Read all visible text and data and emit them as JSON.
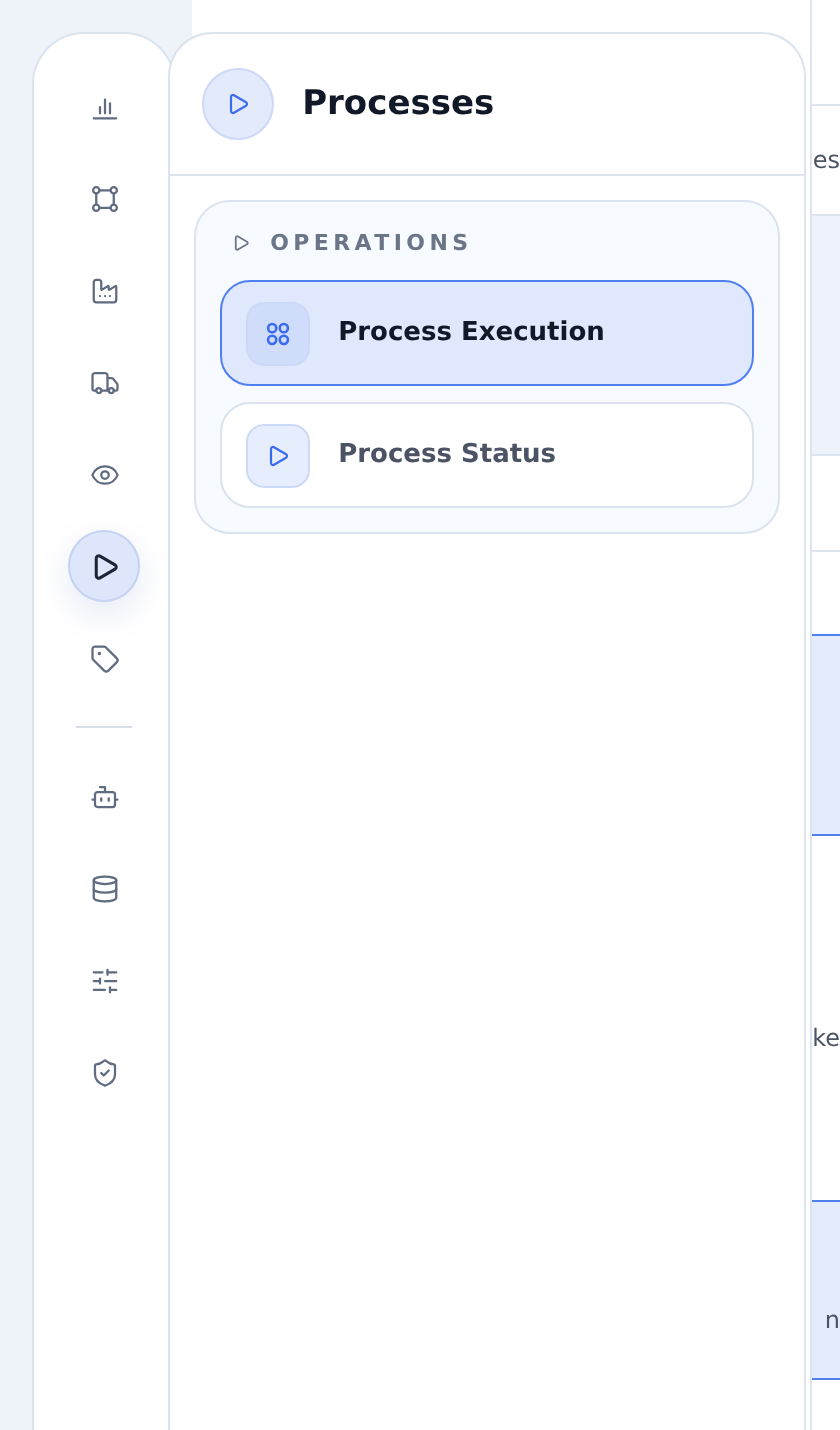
{
  "nav_rail": {
    "groups": [
      {
        "items": [
          {
            "selected": false
          },
          {
            "selected": false
          },
          {
            "selected": false
          },
          {
            "selected": false
          },
          {
            "selected": false
          },
          {
            "selected": true
          },
          {
            "selected": false
          }
        ]
      },
      {
        "items": [
          {
            "selected": false
          },
          {
            "selected": false
          },
          {
            "selected": false
          },
          {
            "selected": false
          }
        ]
      }
    ]
  },
  "panel": {
    "title": "Processes",
    "section": {
      "label": "OPERATIONS",
      "expanded": true,
      "items": [
        {
          "label": "Process Execution",
          "selected": true,
          "kind": "grid"
        },
        {
          "label": "Process Status",
          "selected": false,
          "kind": "play"
        }
      ]
    }
  },
  "background_table": {
    "header_fragment": "es",
    "row_fragments": [
      "ke",
      "n"
    ]
  }
}
